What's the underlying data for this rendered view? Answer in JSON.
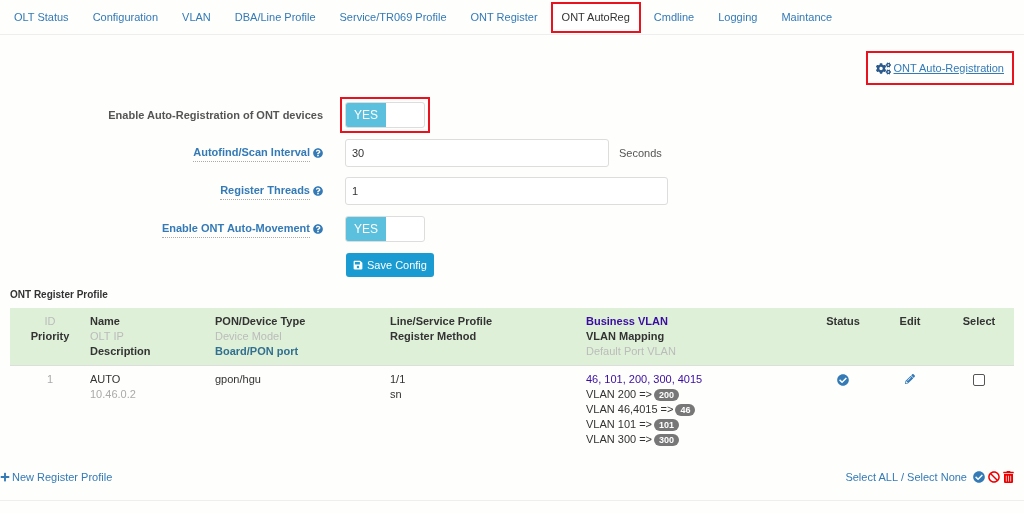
{
  "tabs": [
    {
      "label": "OLT Status",
      "selected": false,
      "highlighted": false
    },
    {
      "label": "Configuration",
      "selected": false,
      "highlighted": false
    },
    {
      "label": "VLAN",
      "selected": false,
      "highlighted": false
    },
    {
      "label": "DBA/Line Profile",
      "selected": false,
      "highlighted": false
    },
    {
      "label": "Service/TR069 Profile",
      "selected": false,
      "highlighted": false
    },
    {
      "label": "ONT Register",
      "selected": false,
      "highlighted": false
    },
    {
      "label": "ONT AutoReg",
      "selected": true,
      "highlighted": true
    },
    {
      "label": "Cmdline",
      "selected": false,
      "highlighted": false
    },
    {
      "label": "Logging",
      "selected": false,
      "highlighted": false
    },
    {
      "label": "Maintance",
      "selected": false,
      "highlighted": false
    }
  ],
  "header_link": {
    "label": "ONT Auto-Registration",
    "highlighted": true
  },
  "form": [
    {
      "kind": "toggle",
      "label": "Enable Auto-Registration of ONT devices",
      "help": false,
      "on": true,
      "on_text": "YES",
      "highlighted": true
    },
    {
      "kind": "input",
      "label": "Autofind/Scan Interval",
      "help": true,
      "value": "30",
      "unit": "Seconds"
    },
    {
      "kind": "input",
      "label": "Register Threads",
      "help": true,
      "value": "1"
    },
    {
      "kind": "toggle",
      "label": "Enable ONT Auto-Movement",
      "help": true,
      "on": true,
      "on_text": "YES",
      "highlighted": false
    }
  ],
  "save_button": "Save Config",
  "section_title": "ONT Register Profile",
  "table": {
    "columns": [
      {
        "lines": [
          {
            "text": "ID",
            "kind": "muted"
          },
          {
            "text": "Priority",
            "kind": "strong"
          }
        ]
      },
      {
        "lines": [
          {
            "text": "Name",
            "kind": "strong"
          },
          {
            "text": "OLT IP",
            "kind": "muted"
          },
          {
            "text": "Description",
            "kind": "strong"
          }
        ]
      },
      {
        "lines": [
          {
            "text": "PON/Device Type",
            "kind": "strong"
          },
          {
            "text": "Device Model",
            "kind": "muted"
          },
          {
            "text": "Board/PON port",
            "kind": "link"
          }
        ]
      },
      {
        "lines": [
          {
            "text": "Line/Service Profile",
            "kind": "strong"
          },
          {
            "text": "Register Method",
            "kind": "strong"
          }
        ]
      },
      {
        "lines": [
          {
            "text": "Business VLAN",
            "kind": "accent"
          },
          {
            "text": "VLAN Mapping",
            "kind": "strong"
          },
          {
            "text": "Default Port VLAN",
            "kind": "muted"
          }
        ]
      },
      {
        "lines": [
          {
            "text": "Status",
            "kind": "strong"
          }
        ]
      },
      {
        "lines": [
          {
            "text": "Edit",
            "kind": "strong"
          }
        ]
      },
      {
        "lines": [
          {
            "text": "Select",
            "kind": "strong"
          }
        ]
      }
    ],
    "rows": [
      {
        "id": "1",
        "name": "AUTO",
        "olt_ip": "10.46.0.2",
        "pon": "gpon/hgu",
        "line_profile": "1/1",
        "method": "sn",
        "business_vlan": "46, 101, 200, 300, 4015",
        "mappings": [
          {
            "from": "VLAN 200 =>",
            "to": "200"
          },
          {
            "from": "VLAN 46,4015 =>",
            "to": "46"
          },
          {
            "from": "VLAN 101 =>",
            "to": "101"
          },
          {
            "from": "VLAN 300 =>",
            "to": "300"
          }
        ],
        "status_ok": true,
        "checked": false
      }
    ]
  },
  "footer": {
    "new_link": "New Register Profile",
    "select_all": "Select ALL",
    "separator": "/",
    "select_none": "Select None"
  }
}
